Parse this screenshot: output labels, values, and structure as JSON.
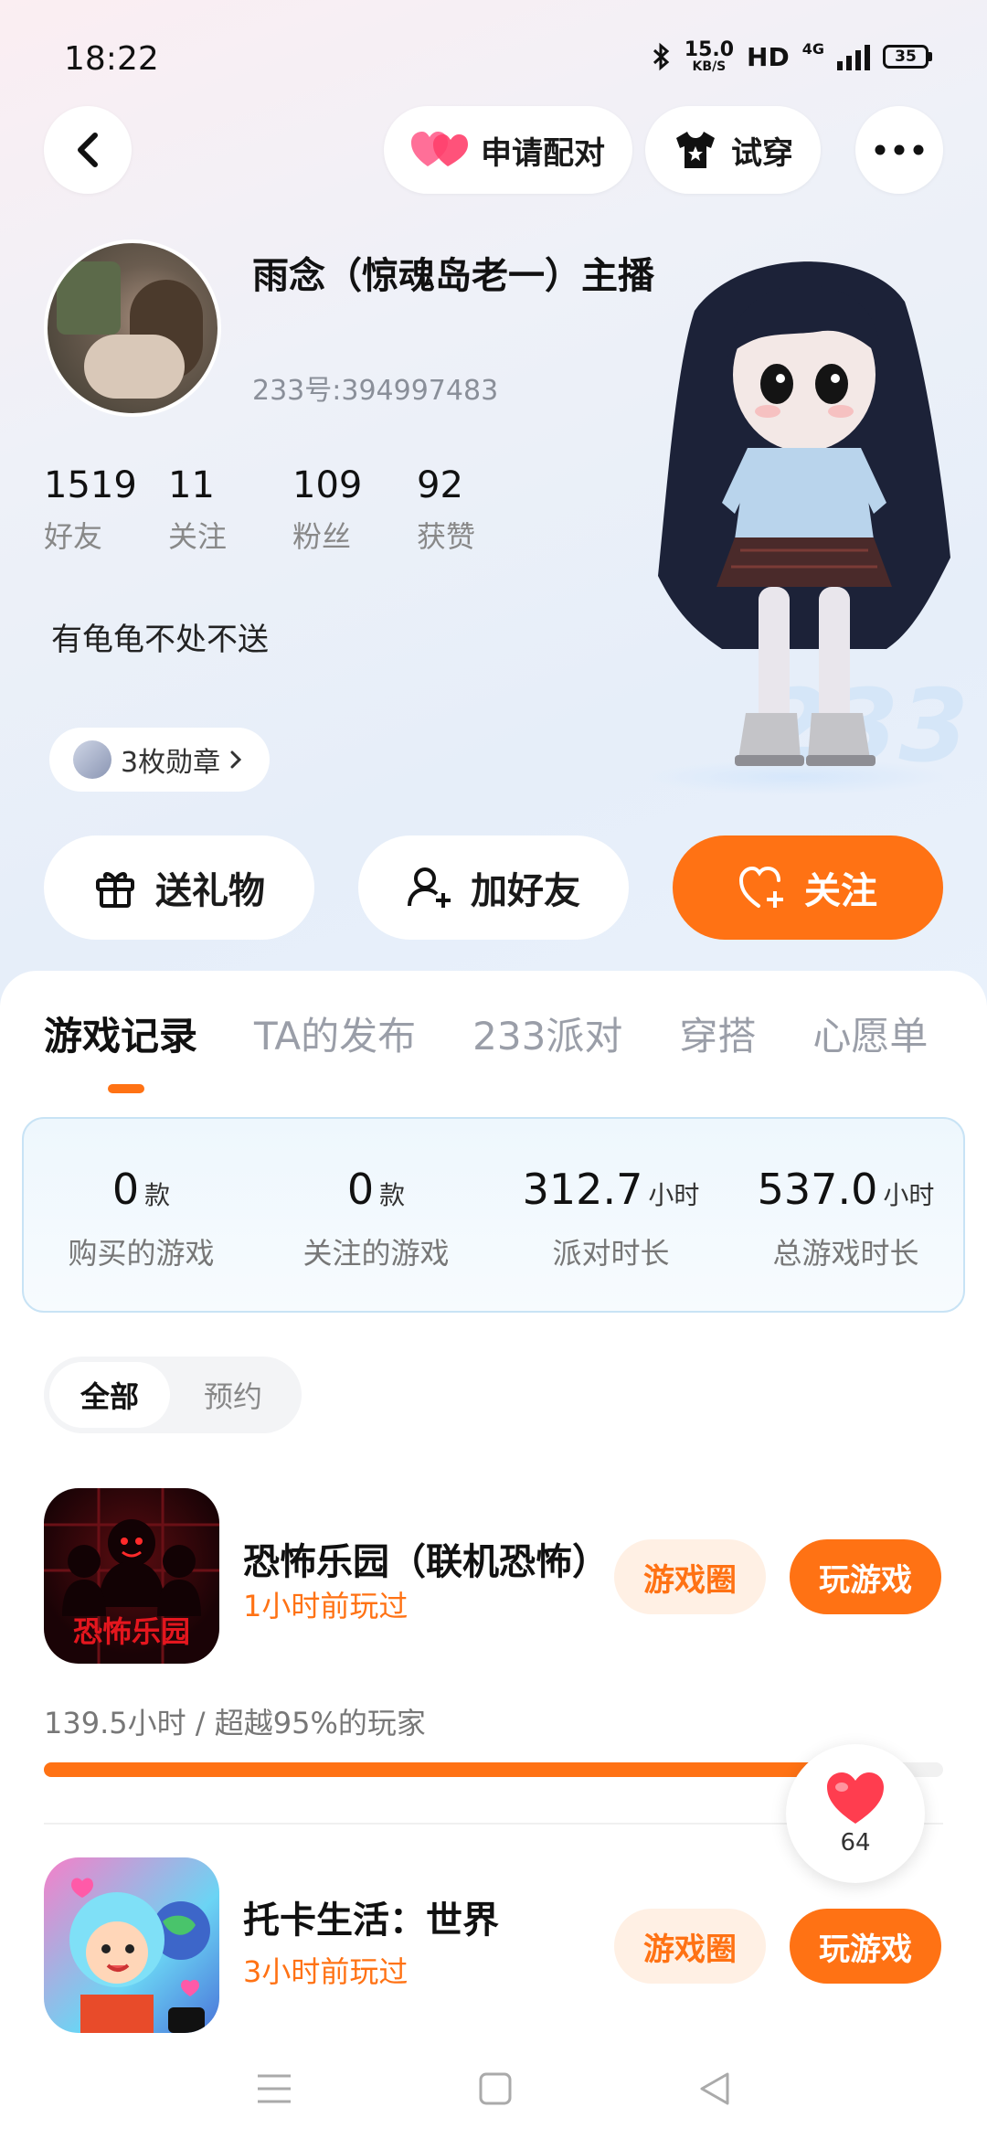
{
  "status_bar": {
    "time": "18:22",
    "speed_value": "15.0",
    "speed_unit": "KB/S",
    "hd": "HD",
    "network": "4G",
    "battery": "35"
  },
  "header": {
    "pair_label": "申请配对",
    "try_label": "试穿"
  },
  "profile": {
    "nickname": "雨念（惊魂岛老一）主播",
    "uid": "233号:394997483",
    "stats": [
      {
        "num": "1519",
        "label": "好友"
      },
      {
        "num": "11",
        "label": "关注"
      },
      {
        "num": "109",
        "label": "粉丝"
      },
      {
        "num": "92",
        "label": "获赞"
      }
    ],
    "bio": "有龟龟不处不送",
    "badge_label": "3枚勋章",
    "logo_text": "233"
  },
  "actions": {
    "gift": "送礼物",
    "add_friend": "加好友",
    "follow": "关注"
  },
  "tabs": [
    "游戏记录",
    "TA的发布",
    "233派对",
    "穿搭",
    "心愿单"
  ],
  "summary": [
    {
      "num": "0",
      "unit": "款",
      "label": "购买的游戏"
    },
    {
      "num": "0",
      "unit": "款",
      "label": "关注的游戏"
    },
    {
      "num": "312.7",
      "unit": "小时",
      "label": "派对时长"
    },
    {
      "num": "537.0",
      "unit": "小时",
      "label": "总游戏时长"
    }
  ],
  "filter": {
    "all": "全部",
    "reserve": "预约"
  },
  "games": [
    {
      "title": "恐怖乐园（联机恐怖）",
      "played": "1小时前玩过",
      "circle_label": "游戏圈",
      "play_label": "玩游戏",
      "icon_text": "恐怖乐园",
      "hours_text": "139.5小时 / 超越95%的玩家",
      "progress_percent": 95
    },
    {
      "title": "托卡生活：世界",
      "played": "3小时前玩过",
      "circle_label": "游戏圈",
      "play_label": "玩游戏"
    }
  ],
  "like_fab": {
    "count": "64"
  },
  "colors": {
    "accent": "#ff7214",
    "accent_light": "#fff0e4",
    "muted": "#8a8f99"
  }
}
